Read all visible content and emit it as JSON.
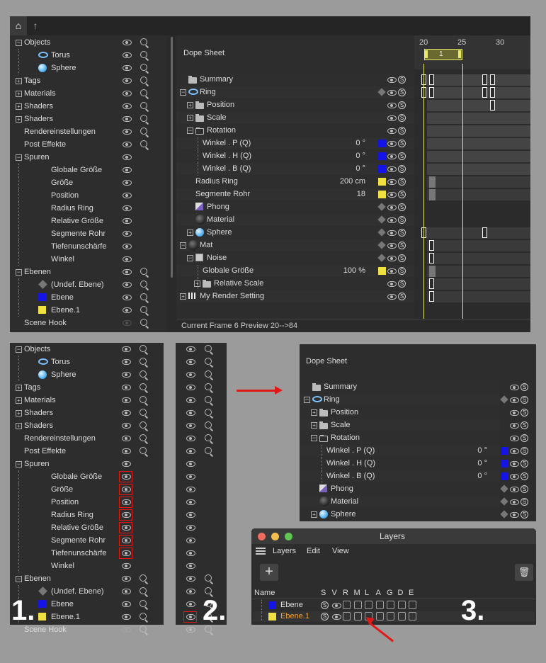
{
  "top": {
    "obj_rows": [
      {
        "label": "Objects",
        "indent": 0,
        "exp": "minus",
        "icon": "",
        "eye": true,
        "mag": true
      },
      {
        "label": "Torus",
        "indent": 2,
        "exp": "",
        "icon": "torus",
        "eye": true,
        "mag": true
      },
      {
        "label": "Sphere",
        "indent": 2,
        "exp": "",
        "icon": "sphere",
        "eye": true,
        "mag": true
      },
      {
        "label": "Tags",
        "indent": 0,
        "exp": "plus",
        "icon": "",
        "eye": true,
        "mag": true
      },
      {
        "label": "Materials",
        "indent": 0,
        "exp": "plus",
        "icon": "",
        "eye": true,
        "mag": true
      },
      {
        "label": "Shaders",
        "indent": 0,
        "exp": "plus",
        "icon": "",
        "eye": true,
        "mag": true
      },
      {
        "label": "Shaders",
        "indent": 0,
        "exp": "plus",
        "icon": "",
        "eye": true,
        "mag": true
      },
      {
        "label": "Rendereinstellungen",
        "indent": 0,
        "exp": "",
        "icon": "",
        "eye": true,
        "mag": true
      },
      {
        "label": "Post Effekte",
        "indent": 0,
        "exp": "",
        "icon": "",
        "eye": true,
        "mag": true
      },
      {
        "label": "Spuren",
        "indent": 0,
        "exp": "minus",
        "icon": "",
        "eye": true,
        "mag": false
      },
      {
        "label": "Globale Größe",
        "indent": 3,
        "exp": "",
        "icon": "",
        "eye": true,
        "mag": false
      },
      {
        "label": "Größe",
        "indent": 3,
        "exp": "",
        "icon": "",
        "eye": true,
        "mag": false
      },
      {
        "label": "Position",
        "indent": 3,
        "exp": "",
        "icon": "",
        "eye": true,
        "mag": false
      },
      {
        "label": "Radius Ring",
        "indent": 3,
        "exp": "",
        "icon": "",
        "eye": true,
        "mag": false
      },
      {
        "label": "Relative Größe",
        "indent": 3,
        "exp": "",
        "icon": "",
        "eye": true,
        "mag": false
      },
      {
        "label": "Segmente Rohr",
        "indent": 3,
        "exp": "",
        "icon": "",
        "eye": true,
        "mag": false
      },
      {
        "label": "Tiefenunschärfe",
        "indent": 3,
        "exp": "",
        "icon": "",
        "eye": true,
        "mag": false
      },
      {
        "label": "Winkel",
        "indent": 3,
        "exp": "",
        "icon": "",
        "eye": true,
        "mag": false
      },
      {
        "label": "Ebenen",
        "indent": 0,
        "exp": "minus",
        "icon": "",
        "eye": true,
        "mag": true
      },
      {
        "label": "(Undef. Ebene)",
        "indent": 2,
        "exp": "",
        "icon": "layer",
        "eye": true,
        "mag": true
      },
      {
        "label": "Ebene",
        "indent": 2,
        "exp": "",
        "icon": "blue",
        "eye": true,
        "mag": true
      },
      {
        "label": "Ebene.1",
        "indent": 2,
        "exp": "",
        "icon": "yellow",
        "eye": true,
        "mag": true
      },
      {
        "label": "Scene Hook",
        "indent": 0,
        "exp": "",
        "icon": "",
        "eye": false,
        "mag": true
      }
    ],
    "dope_title": "Dope Sheet",
    "ticks": [
      "20",
      "25",
      "30"
    ],
    "range_label": "1",
    "dope_rows": [
      {
        "label": "Summary",
        "indent": 0,
        "exp": "",
        "icon": "folder",
        "value": "",
        "sw": "",
        "layer": false
      },
      {
        "label": "Ring",
        "indent": 0,
        "exp": "minus",
        "icon": "torus",
        "value": "",
        "sw": "",
        "layer": true
      },
      {
        "label": "Position",
        "indent": 1,
        "exp": "plus",
        "icon": "folder",
        "value": "",
        "sw": "",
        "layer": false
      },
      {
        "label": "Scale",
        "indent": 1,
        "exp": "plus",
        "icon": "folder",
        "value": "",
        "sw": "",
        "layer": false
      },
      {
        "label": "Rotation",
        "indent": 1,
        "exp": "minus",
        "icon": "folderO",
        "value": "",
        "sw": "",
        "layer": false
      },
      {
        "label": "Winkel . P   (Q)",
        "indent": 2,
        "exp": "",
        "icon": "",
        "value": "0 °",
        "sw": "#1414e6",
        "layer": false
      },
      {
        "label": "Winkel . H   (Q)",
        "indent": 2,
        "exp": "",
        "icon": "",
        "value": "0 °",
        "sw": "#1414e6",
        "layer": false
      },
      {
        "label": "Winkel . B   (Q)",
        "indent": 2,
        "exp": "",
        "icon": "",
        "value": "0 °",
        "sw": "#1414e6",
        "layer": false
      },
      {
        "label": "Radius Ring",
        "indent": 1,
        "exp": "",
        "icon": "",
        "value": "200 cm",
        "sw": "#f0e040",
        "layer": false
      },
      {
        "label": "Segmente Rohr",
        "indent": 1,
        "exp": "",
        "icon": "",
        "value": "18",
        "sw": "#f0e040",
        "layer": false
      },
      {
        "label": "Phong",
        "indent": 1,
        "exp": "",
        "icon": "phong",
        "value": "",
        "sw": "",
        "layer": true
      },
      {
        "label": "Material",
        "indent": 1,
        "exp": "",
        "icon": "ball",
        "value": "",
        "sw": "",
        "layer": true
      },
      {
        "label": "Sphere",
        "indent": 1,
        "exp": "plus",
        "icon": "sphere",
        "value": "",
        "sw": "",
        "layer": true
      },
      {
        "label": "Mat",
        "indent": 0,
        "exp": "minus",
        "icon": "ball",
        "value": "",
        "sw": "",
        "layer": true
      },
      {
        "label": "Noise",
        "indent": 1,
        "exp": "minus",
        "icon": "image",
        "value": "",
        "sw": "",
        "layer": true
      },
      {
        "label": "Globale Größe",
        "indent": 2,
        "exp": "",
        "icon": "",
        "value": "100 %",
        "sw": "#f0e040",
        "layer": false
      },
      {
        "label": "Relative Scale",
        "indent": 2,
        "exp": "plus",
        "icon": "folder",
        "value": "",
        "sw": "",
        "layer": false
      },
      {
        "label": "My Render Setting",
        "indent": 0,
        "exp": "plus",
        "icon": "clap",
        "value": "",
        "sw": "",
        "layer": false
      }
    ],
    "status": "Current Frame  6  Preview  20-->84"
  },
  "step1": {
    "number": "1."
  },
  "step2": {
    "number": "2."
  },
  "step3": {
    "number": "3."
  },
  "mini_dope": {
    "title": "Dope Sheet",
    "rows": [
      {
        "label": "Summary",
        "indent": 0,
        "exp": "",
        "icon": "folder",
        "value": "",
        "sw": "",
        "layer": false
      },
      {
        "label": "Ring",
        "indent": 0,
        "exp": "minus",
        "icon": "torus",
        "value": "",
        "sw": "",
        "layer": true
      },
      {
        "label": "Position",
        "indent": 1,
        "exp": "plus",
        "icon": "folder",
        "value": "",
        "sw": "",
        "layer": false
      },
      {
        "label": "Scale",
        "indent": 1,
        "exp": "plus",
        "icon": "folder",
        "value": "",
        "sw": "",
        "layer": false
      },
      {
        "label": "Rotation",
        "indent": 1,
        "exp": "minus",
        "icon": "folderO",
        "value": "",
        "sw": "",
        "layer": false
      },
      {
        "label": "Winkel . P   (Q)",
        "indent": 2,
        "exp": "",
        "icon": "",
        "value": "0 °",
        "sw": "#1414e6",
        "layer": false
      },
      {
        "label": "Winkel . H   (Q)",
        "indent": 2,
        "exp": "",
        "icon": "",
        "value": "0 °",
        "sw": "#1414e6",
        "layer": false
      },
      {
        "label": "Winkel . B   (Q)",
        "indent": 2,
        "exp": "",
        "icon": "",
        "value": "0 °",
        "sw": "#1414e6",
        "layer": false
      },
      {
        "label": "Phong",
        "indent": 1,
        "exp": "",
        "icon": "phong",
        "value": "",
        "sw": "",
        "layer": true
      },
      {
        "label": "Material",
        "indent": 1,
        "exp": "",
        "icon": "ball",
        "value": "",
        "sw": "",
        "layer": true
      },
      {
        "label": "Sphere",
        "indent": 1,
        "exp": "plus",
        "icon": "sphere",
        "value": "",
        "sw": "",
        "layer": true
      }
    ]
  },
  "layers": {
    "title": "Layers",
    "menu": [
      "Layers",
      "Edit",
      "View"
    ],
    "add_label": "+",
    "columns": {
      "name": "Name",
      "flags": [
        "S",
        "V",
        "R",
        "M",
        "L",
        "A",
        "G",
        "D",
        "E"
      ]
    },
    "items": [
      {
        "name": "Ebene",
        "color": "#1414e6",
        "selected": false
      },
      {
        "name": "Ebene.1",
        "color": "#f0e040",
        "selected": true
      }
    ]
  },
  "colors": {
    "accent_red": "#e01818",
    "timeline_yellow": "#e8e86a",
    "bg": "#2d2d2d"
  }
}
